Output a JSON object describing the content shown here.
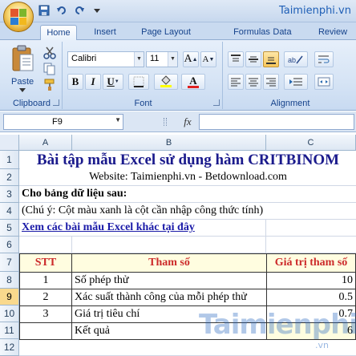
{
  "watermark": {
    "site": "Taimienphi.vn",
    "big": "Taimienphi",
    "suffix": ".vn"
  },
  "ribbon": {
    "tabs": [
      "Home",
      "Insert",
      "Page Layout",
      "Formulas",
      "Data",
      "Review"
    ],
    "active_tab": "Home",
    "clipboard": {
      "label": "Clipboard",
      "paste_label": "Paste"
    },
    "font": {
      "label": "Font",
      "family": "Calibri",
      "size": "11",
      "bold": "B",
      "italic": "I",
      "underline": "U",
      "grow": "A",
      "shrink": "A",
      "font_color": "A"
    },
    "alignment": {
      "label": "Alignment"
    }
  },
  "formula_bar": {
    "name_box": "F9",
    "fx": "fx",
    "formula": ""
  },
  "columns": [
    "A",
    "B",
    "C"
  ],
  "rows": [
    "1",
    "2",
    "3",
    "4",
    "5",
    "6",
    "7",
    "8",
    "9",
    "10",
    "11",
    "12"
  ],
  "selected_row": "9",
  "sheet": {
    "title": "Bài tập mẫu Excel sử dụng hàm CRITBINOM",
    "website": "Website: Taimienphi.vn - Betdownload.com",
    "given": "Cho bảng dữ liệu sau:",
    "note": "(Chú ý: Cột màu xanh là cột cần nhập công thức tính)",
    "link": "Xem các bài mẫu Excel khác tại đây",
    "table": {
      "headers": [
        "STT",
        "Tham số",
        "Giá trị tham số"
      ],
      "rows": [
        {
          "stt": "1",
          "param": "Số phép thử",
          "value": "10"
        },
        {
          "stt": "2",
          "param": "Xác suất thành công của mỗi phép thử",
          "value": "0.5"
        },
        {
          "stt": "3",
          "param": "Giá trị tiêu chí",
          "value": "0.7"
        },
        {
          "stt": "",
          "param": "Kết quả",
          "value": "6"
        }
      ]
    }
  },
  "colors": {
    "header_text": "#cc2a2a",
    "header_fill": "#fffde0",
    "link": "#1a1aa8",
    "title": "#1a1a8c",
    "selected_row": "#f9d98d"
  }
}
